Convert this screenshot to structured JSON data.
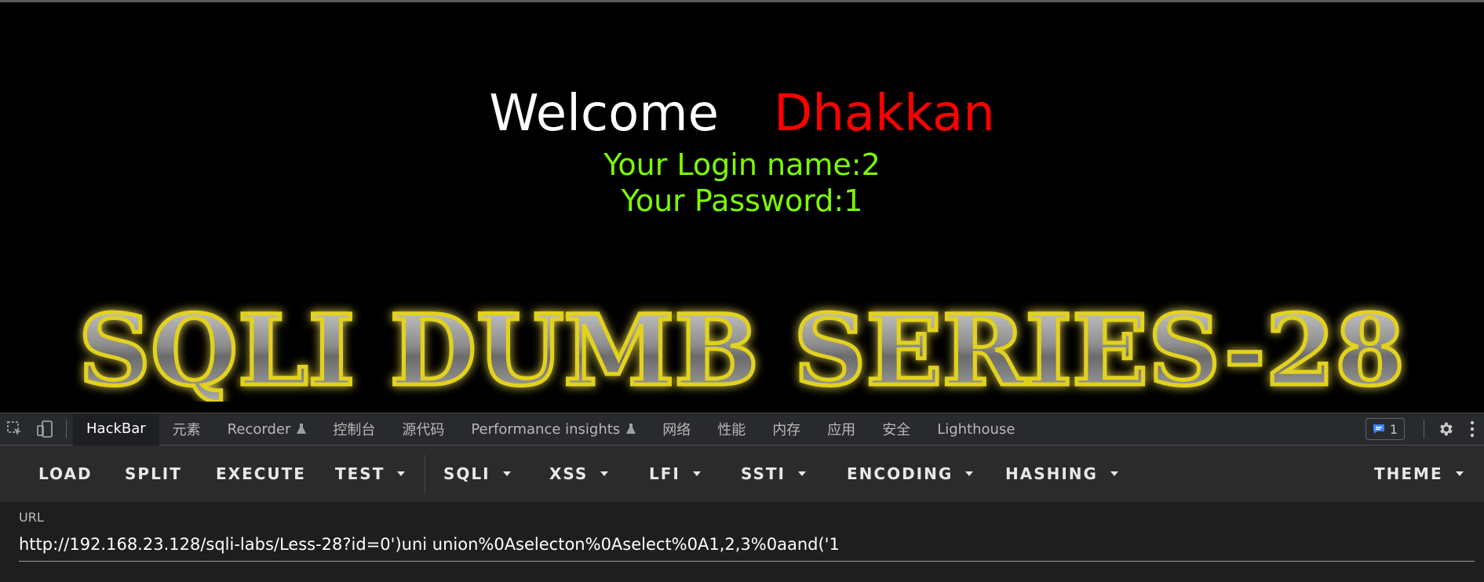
{
  "page": {
    "welcome_word": "Welcome",
    "welcome_name": "Dhakkan",
    "login_name": "Your Login name:2",
    "password": "Your Password:1",
    "banner_text": "SQLI DUMB SERIES-28"
  },
  "devtools": {
    "tabs": [
      {
        "label": "HackBar",
        "active": true
      },
      {
        "label": "元素"
      },
      {
        "label": "Recorder",
        "experimental": true
      },
      {
        "label": "控制台"
      },
      {
        "label": "源代码"
      },
      {
        "label": "Performance insights",
        "experimental": true
      },
      {
        "label": "网络"
      },
      {
        "label": "性能"
      },
      {
        "label": "内存"
      },
      {
        "label": "应用"
      },
      {
        "label": "安全"
      },
      {
        "label": "Lighthouse"
      }
    ],
    "issues_count": "1",
    "icons": [
      "inspect-element-icon",
      "device-toolbar-icon",
      "issues-icon",
      "settings-gear-icon",
      "more-vertical-icon"
    ]
  },
  "hackbar": {
    "buttons": [
      "LOAD",
      "SPLIT",
      "EXECUTE"
    ],
    "dropdowns": [
      "TEST",
      "SQLI",
      "XSS",
      "LFI",
      "SSTI",
      "ENCODING",
      "HASHING",
      "THEME"
    ],
    "url_label": "URL",
    "url_value": "http://192.168.23.128/sqli-labs/Less-28?id=0')uni union%0Aselecton%0Aselect%0A1,2,3%0aand('1"
  },
  "colors": {
    "background": "#000000",
    "welcome_name": "#ff0000",
    "login_text": "#7cfc00",
    "devtools_bar": "#292a2d",
    "hackbar_toolbar": "#2b2b2b",
    "url_panel": "#1e1e1e"
  }
}
